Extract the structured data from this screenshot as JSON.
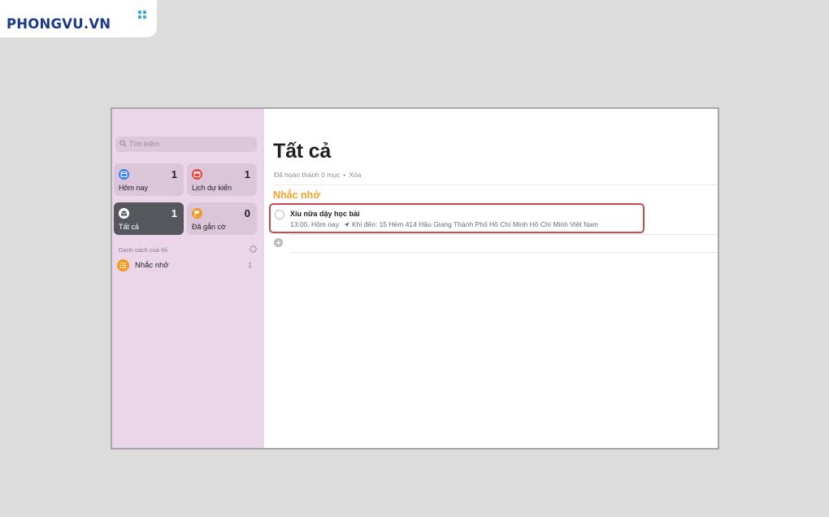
{
  "brand": {
    "logo_text": "PHONGVU.VN",
    "color": "#1b3a8c",
    "accent": "#33a9e0"
  },
  "sidebar": {
    "search": {
      "placeholder": "Tìm kiếm",
      "icon": "search-icon"
    },
    "smart_lists": [
      {
        "label": "Hôm nay",
        "count": "1",
        "icon": "calendar-today-icon",
        "color": "#3d82f0",
        "selected": false
      },
      {
        "label": "Lịch dự kiến",
        "count": "1",
        "icon": "calendar-scheduled-icon",
        "color": "#e8433e",
        "selected": false
      },
      {
        "label": "Tất cả",
        "count": "1",
        "icon": "tray-icon",
        "color": "#5a5a5e",
        "selected": true
      },
      {
        "label": "Đã gắn cờ",
        "count": "0",
        "icon": "flag-icon",
        "color": "#f29a1f",
        "selected": false
      }
    ],
    "section_title": "Danh sách của tôi",
    "lists": [
      {
        "label": "Nhắc nhở",
        "count": "1",
        "icon": "list-bullet-icon",
        "color": "#f29a1f"
      }
    ]
  },
  "main": {
    "title": "Tất cả",
    "completed_text": "Đã hoàn thành 0 mục",
    "separator": "•",
    "clear_label": "Xóa",
    "group_title": "Nhắc nhở",
    "group_color": "#f0a228",
    "reminders": [
      {
        "title": "Xíu nữa dậy học bài",
        "time": "13:00, Hôm nay",
        "location": "Khi đến: 15 Hẻm 414 Hậu Giang Thành Phố Hồ Chí Minh Hồ Chí Minh Việt Nam"
      }
    ]
  }
}
